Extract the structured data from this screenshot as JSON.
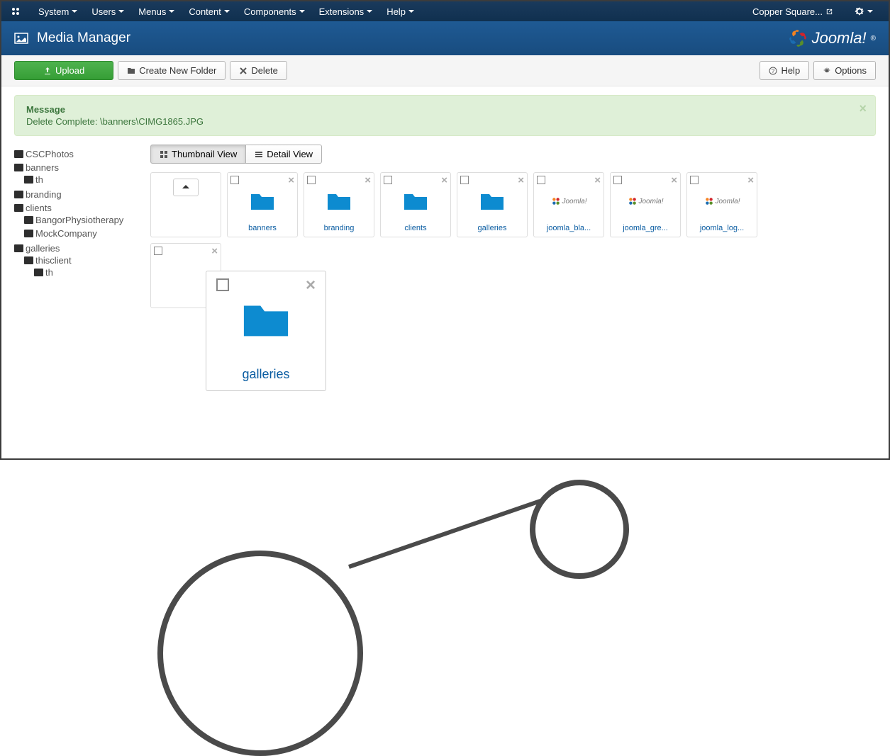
{
  "menubar": {
    "items": [
      "System",
      "Users",
      "Menus",
      "Content",
      "Components",
      "Extensions",
      "Help"
    ],
    "site_name": "Copper Square..."
  },
  "titlebar": {
    "title": "Media Manager",
    "brand": "Joomla!"
  },
  "toolbar": {
    "upload": "Upload",
    "create_folder": "Create New Folder",
    "delete": "Delete",
    "help": "Help",
    "options": "Options"
  },
  "alert": {
    "title": "Message",
    "body": "Delete Complete: \\banners\\CIMG1865.JPG"
  },
  "views": {
    "thumbnail": "Thumbnail View",
    "detail": "Detail View"
  },
  "tree": [
    {
      "label": "CSCPhotos",
      "children": []
    },
    {
      "label": "banners",
      "children": [
        {
          "label": "th",
          "children": []
        }
      ]
    },
    {
      "label": "branding",
      "children": []
    },
    {
      "label": "clients",
      "children": [
        {
          "label": "BangorPhysiotherapy",
          "children": []
        },
        {
          "label": "MockCompany",
          "children": []
        }
      ]
    },
    {
      "label": "galleries",
      "children": [
        {
          "label": "thisclient",
          "children": [
            {
              "label": "th",
              "children": []
            }
          ]
        }
      ]
    }
  ],
  "grid": {
    "up_label": "..",
    "items": [
      {
        "type": "folder",
        "label": "banners"
      },
      {
        "type": "folder",
        "label": "branding"
      },
      {
        "type": "folder",
        "label": "clients"
      },
      {
        "type": "folder",
        "label": "galleries"
      },
      {
        "type": "image",
        "label": "joomla_bla..."
      },
      {
        "type": "image",
        "label": "joomla_gre..."
      },
      {
        "type": "image",
        "label": "joomla_log..."
      }
    ],
    "row2_partial": [
      {
        "type": "image",
        "label": ""
      }
    ]
  },
  "zoom": {
    "label": "galleries"
  },
  "colors": {
    "folder_blue": "#0d8bd0",
    "link_blue": "#0b5da2",
    "alert_green_bg": "#dff0d8",
    "alert_green_text": "#3c763d"
  }
}
